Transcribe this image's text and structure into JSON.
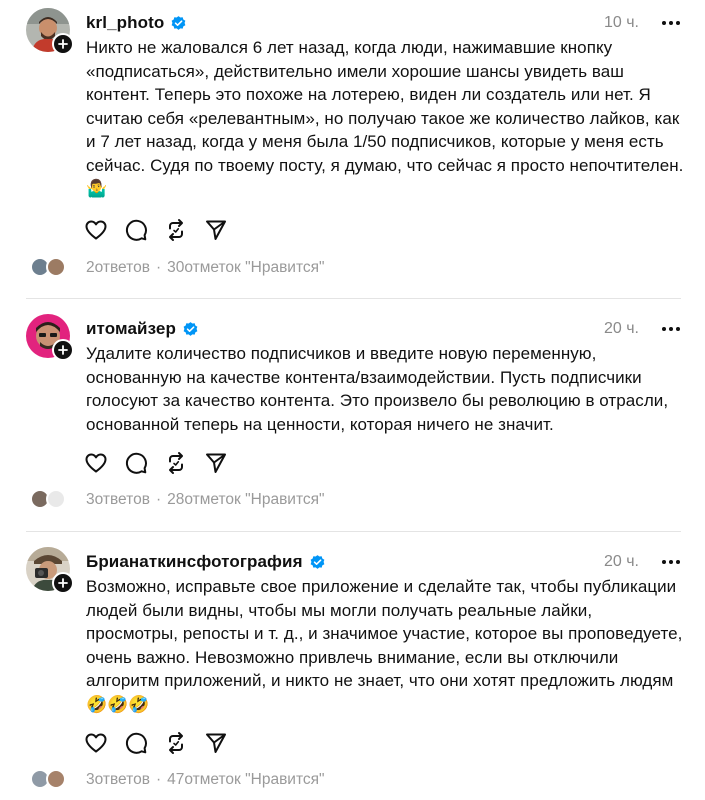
{
  "posts": [
    {
      "username": "krl_photo",
      "time": "10 ч.",
      "text": "Никто не жаловался 6 лет назад, когда люди, нажимавшие кнопку «подписаться», действительно имели хорошие шансы увидеть ваш контент. Теперь это похоже на лотерею, виден ли создатель или нет. Я считаю себя «релевантным», но получаю такое же количество лайков, как и 7 лет назад, когда у меня была 1/50 подписчиков, которые у меня есть сейчас. Судя по твоему посту, я думаю, что сейчас я просто непочтителен. 🤷‍♂️",
      "replies": "2ответов",
      "separator": "·",
      "likes": "30отметок \"Нравится\""
    },
    {
      "username": "итомайзер",
      "time": "20 ч.",
      "text": "Удалите количество подписчиков и введите новую переменную, основанную на качестве контента/взаимодействии. Пусть подписчики голосуют за качество контента. Это произвело бы революцию в отрасли, основанной теперь на ценности, которая ничего не значит.",
      "replies": "3ответов",
      "separator": "·",
      "likes": "28отметок \"Нравится\""
    },
    {
      "username": "Брианаткинсфотография",
      "time": "20 ч.",
      "text": "Возможно, исправьте свое приложение и сделайте так, чтобы публикации людей были видны, чтобы мы могли получать реальные лайки, просмотры, репосты и т. д., и значимое участие, которое вы проповедуете, очень важно. Невозможно привлечь внимание, если вы отключили алгоритм приложений, и никто не знает, что они хотят предложить людям 🤣🤣🤣",
      "replies": "3ответов",
      "separator": "·",
      "likes": "47отметок \"Нравится\""
    }
  ],
  "icons": {
    "verified": "verified-badge-icon",
    "more": "more-options-icon",
    "like": "heart-icon",
    "reply": "comment-icon",
    "repost": "repost-icon",
    "share": "send-icon",
    "follow": "plus-icon"
  },
  "colors": {
    "verified": "#0095f6",
    "text": "#101010",
    "muted": "#9a9a9a",
    "divider": "#e4e4e4"
  }
}
